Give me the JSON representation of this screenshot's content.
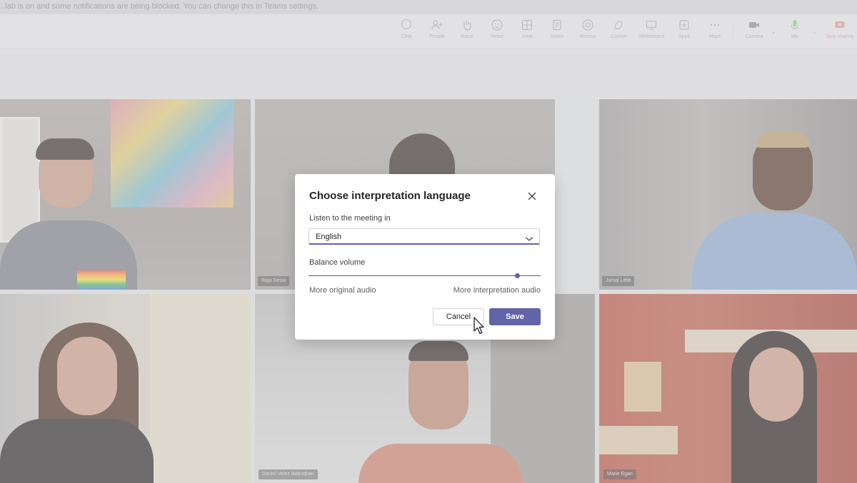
{
  "notification": {
    "text": "...lab is on and some notifications are being blocked. You can change this in Teams settings."
  },
  "toolbar": {
    "items": [
      {
        "label": "Chat",
        "icon": "chat-icon"
      },
      {
        "label": "People",
        "icon": "people-icon"
      },
      {
        "label": "Raise",
        "icon": "raise-hand-icon"
      },
      {
        "label": "React",
        "icon": "react-icon"
      },
      {
        "label": "View",
        "icon": "view-icon"
      },
      {
        "label": "Notes",
        "icon": "notes-icon"
      },
      {
        "label": "Rooms",
        "icon": "rooms-icon"
      },
      {
        "label": "Copilot",
        "icon": "copilot-icon"
      },
      {
        "label": "Whiteboard",
        "icon": "whiteboard-icon"
      },
      {
        "label": "Apps",
        "icon": "apps-icon"
      },
      {
        "label": "More",
        "icon": "more-icon"
      },
      {
        "label": "Camera",
        "icon": "camera-icon"
      },
      {
        "label": "Mic",
        "icon": "mic-icon"
      },
      {
        "label": "Stop sharing",
        "icon": "stop-sharing-icon"
      }
    ]
  },
  "participants": [
    {
      "name": "",
      "tile": "top-left"
    },
    {
      "name": "Raja Desai",
      "tile": "top-center"
    },
    {
      "name": "Jamal Little",
      "tile": "top-right"
    },
    {
      "name": "",
      "tile": "bottom-left"
    },
    {
      "name": "Daniel Velez Babudhan",
      "tile": "bottom-center"
    },
    {
      "name": "Marie Egan",
      "tile": "bottom-right"
    }
  ],
  "dialog": {
    "title": "Choose interpretation language",
    "listen_label": "Listen to the meeting in",
    "language_value": "English",
    "balance_label": "Balance volume",
    "balance_value": 0.9,
    "balance_min_label": "More original audio",
    "balance_max_label": "More interpretation audio",
    "cancel_label": "Cancel",
    "save_label": "Save",
    "accent_color": "#6264a7"
  }
}
